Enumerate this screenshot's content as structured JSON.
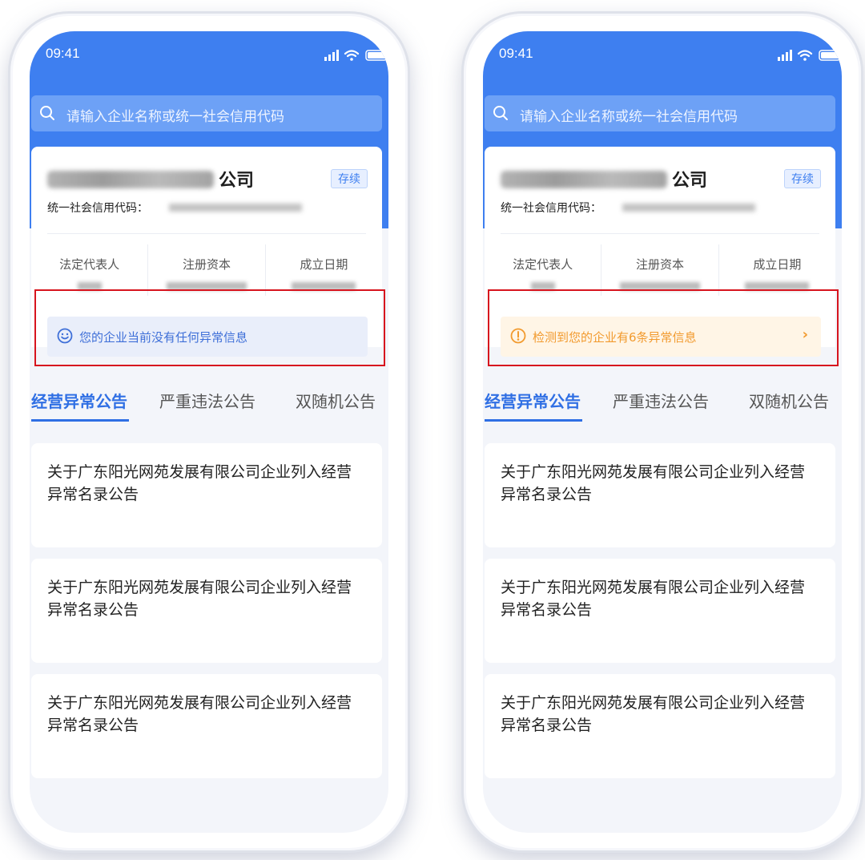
{
  "colors": {
    "primary_blue": "#3e7ff0",
    "notice_ok_text": "#3e6fd8",
    "notice_warn_text": "#f29a2e",
    "highlight_red": "#d7141e"
  },
  "phones": [
    {
      "time": "09:41",
      "search_placeholder": "请输入企业名称或统一社会信用代码",
      "company_name_suffix": "公司",
      "status_badge": "存续",
      "credit_code_label": "统一社会信用代码：",
      "info_labels": [
        "法定代表人",
        "注册资本",
        "成立日期"
      ],
      "notice_text": "您的企业当前没有任何异常信息",
      "notice_icon": "smile-icon",
      "tabs": [
        "经营异常公告",
        "严重违法公告",
        "双随机公告"
      ],
      "announcements": [
        "关于广东阳光网苑发展有限公司企业列入经营异常名录公告",
        "关于广东阳光网苑发展有限公司企业列入经营异常名录公告",
        "关于广东阳光网苑发展有限公司企业列入经营异常名录公告"
      ]
    },
    {
      "time": "09:41",
      "search_placeholder": "请输入企业名称或统一社会信用代码",
      "company_name_suffix": "公司",
      "status_badge": "存续",
      "credit_code_label": "统一社会信用代码：",
      "info_labels": [
        "法定代表人",
        "注册资本",
        "成立日期"
      ],
      "notice_text": "检测到您的企业有6条异常信息",
      "notice_icon": "warning-icon",
      "notice_chevron": "›",
      "tabs": [
        "经营异常公告",
        "严重违法公告",
        "双随机公告"
      ],
      "announcements": [
        "关于广东阳光网苑发展有限公司企业列入经营异常名录公告",
        "关于广东阳光网苑发展有限公司企业列入经营异常名录公告",
        "关于广东阳光网苑发展有限公司企业列入经营异常名录公告"
      ]
    }
  ]
}
